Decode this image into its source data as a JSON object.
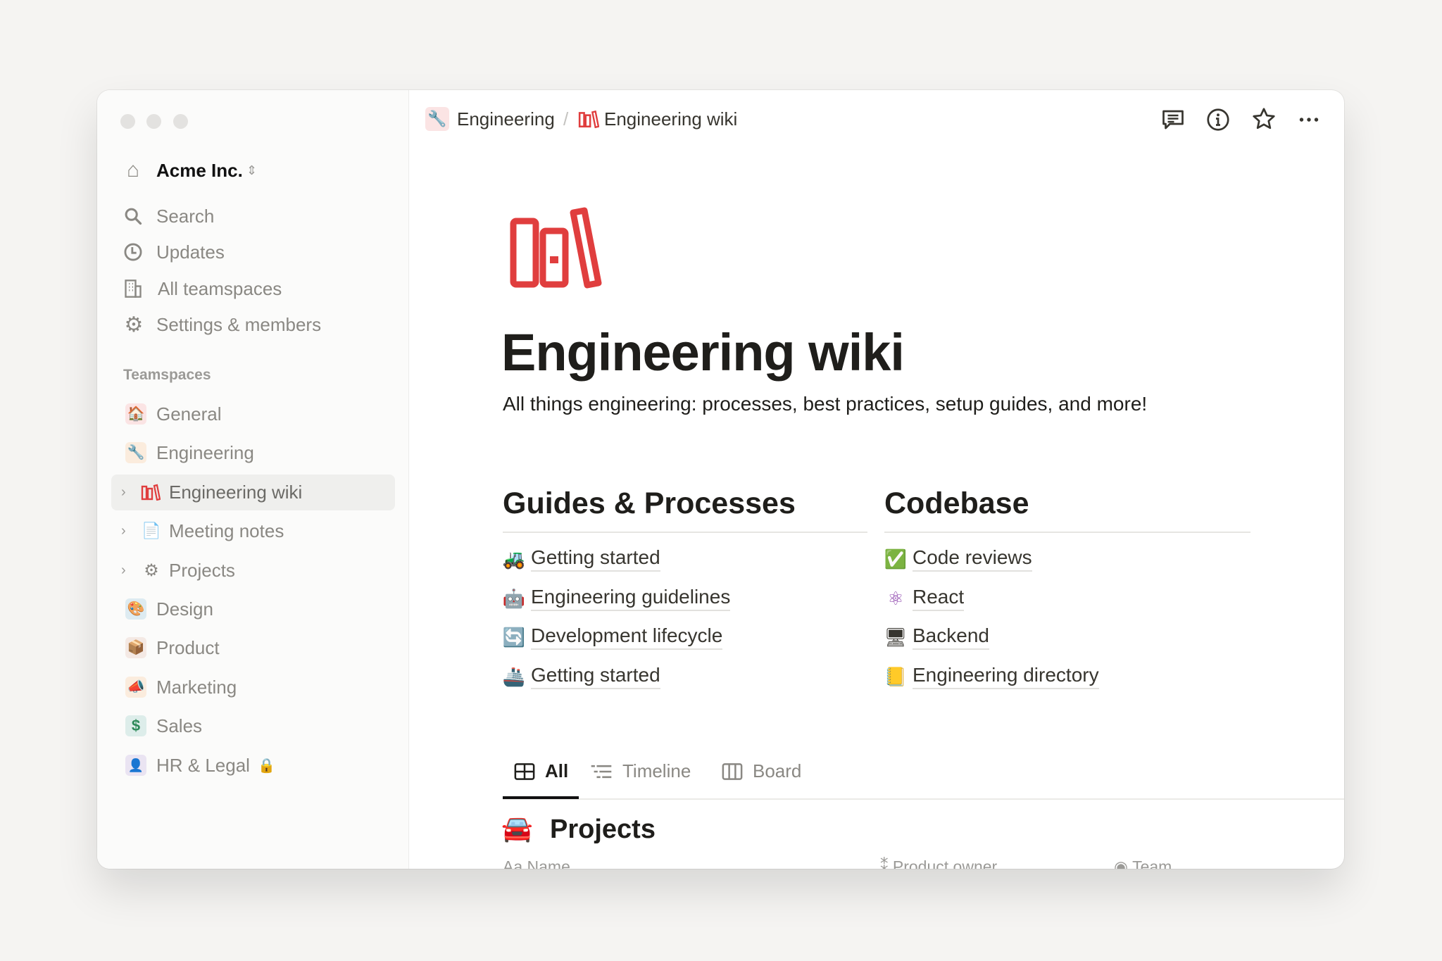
{
  "breadcrumb": [
    {
      "icon": "wrench-icon",
      "label": "Engineering"
    },
    {
      "separator": "/"
    },
    {
      "icon": "books-icon",
      "label": "Engineering wiki"
    }
  ],
  "workspace": {
    "name": "Acme Inc."
  },
  "nav": [
    {
      "label": "Search"
    },
    {
      "label": "Updates"
    },
    {
      "label": "All teamspaces"
    },
    {
      "label": "Settings & members"
    }
  ],
  "teamspaces_label": "Teamspaces",
  "teamspaces": [
    {
      "label": "General",
      "emoji": "🏠"
    },
    {
      "label": "Engineering",
      "emoji": "🔧"
    },
    {
      "label": "Engineering wiki",
      "emoji": "📚"
    },
    {
      "label": "Meeting notes",
      "emoji": "📄"
    },
    {
      "label": "Projects",
      "emoji": "⚙"
    },
    {
      "label": "Design",
      "emoji": "🎨"
    },
    {
      "label": "Product",
      "emoji": "📦"
    },
    {
      "label": "Marketing",
      "emoji": "📣"
    },
    {
      "label": "Sales",
      "emoji": "$"
    },
    {
      "label": "HR & Legal",
      "emoji": "👤"
    }
  ],
  "page": {
    "title": "Engineering wiki",
    "subtitle": "All things engineering: processes, best practices, setup guides, and more!",
    "accent": "#e03e3e",
    "columns": [
      {
        "heading": "Guides & Processes",
        "links": [
          {
            "emoji": "🚜",
            "label": "Getting started"
          },
          {
            "emoji": "🤖",
            "label": "Engineering guidelines"
          },
          {
            "emoji": "🔄",
            "label": "Development lifecycle"
          },
          {
            "emoji": "🚢",
            "label": "Getting started"
          }
        ]
      },
      {
        "heading": "Codebase",
        "links": [
          {
            "emoji": "✅",
            "label": "Code reviews"
          },
          {
            "emoji": "⚛",
            "label": "React"
          },
          {
            "emoji": "🖥",
            "label": "Backend"
          },
          {
            "emoji": "📒",
            "label": "Engineering directory"
          }
        ]
      }
    ],
    "tabs": [
      {
        "label": "All"
      },
      {
        "label": "Timeline"
      },
      {
        "label": "Board"
      }
    ],
    "database": {
      "emoji": "🚘",
      "title": "Projects",
      "columns": [
        {
          "icon": "Aa",
          "label": "Name"
        },
        {
          "label": "Product owner"
        },
        {
          "label": "Team"
        }
      ]
    }
  }
}
